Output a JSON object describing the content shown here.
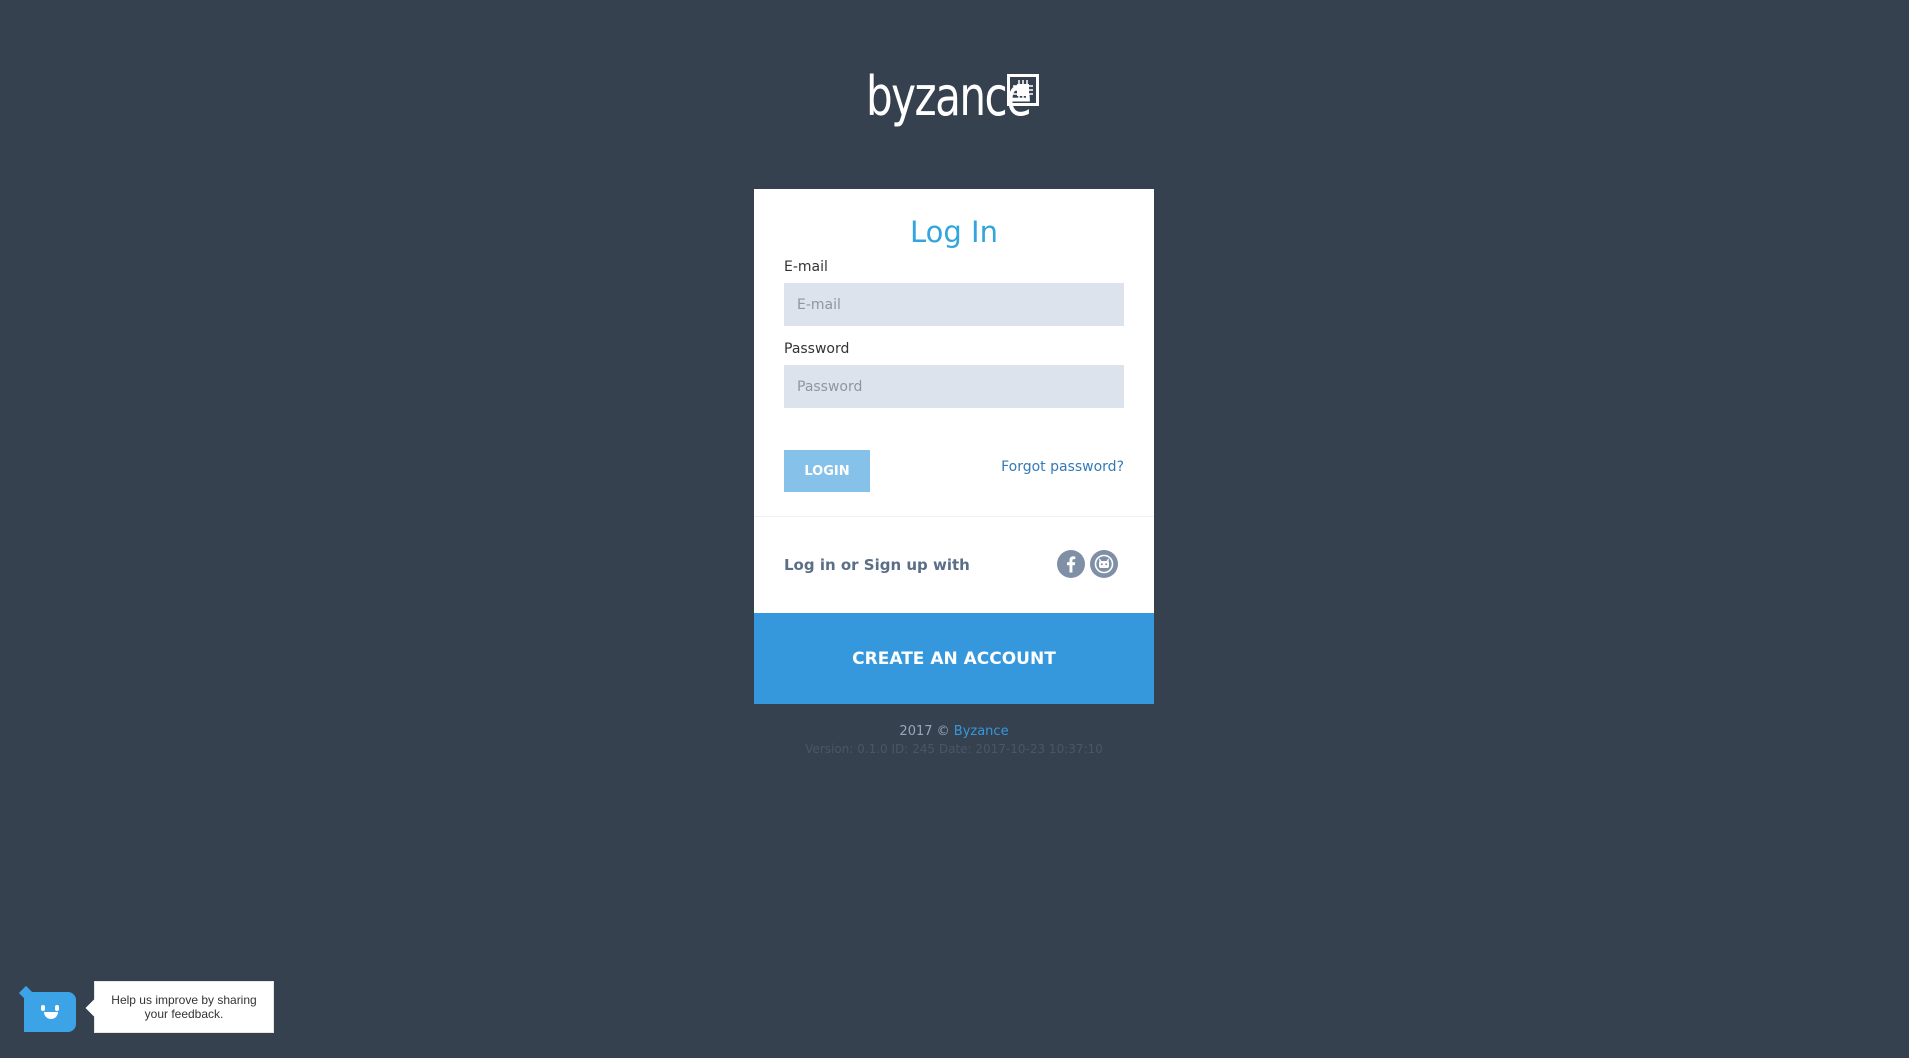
{
  "logo": {
    "text": "byzance",
    "icon": "chip-icon"
  },
  "login_card": {
    "title": "Log In",
    "email": {
      "label": "E-mail",
      "placeholder": "E-mail",
      "value": ""
    },
    "password": {
      "label": "Password",
      "placeholder": "Password",
      "value": ""
    },
    "login_button": "LOGIN",
    "forgot_password": "Forgot password?",
    "social": {
      "label": "Log in or Sign up with",
      "providers": [
        {
          "name": "facebook",
          "icon": "facebook-icon"
        },
        {
          "name": "github",
          "icon": "github-icon"
        }
      ]
    },
    "create_account_button": "CREATE AN ACCOUNT"
  },
  "footer": {
    "copyright_prefix": "2017 ©",
    "copyright_link": "Byzance",
    "version": "Version: 0.1.0 ID: 245 Date: 2017-10-23 10:37:10"
  },
  "feedback_widget": {
    "icon": "smiley-icon",
    "message": "Help us improve by sharing your feedback."
  },
  "colors": {
    "background": "#364150",
    "accent": "#3598dc",
    "title": "#32a5dc",
    "input_bg": "#dde3ec",
    "login_button": "#85c1e9"
  }
}
